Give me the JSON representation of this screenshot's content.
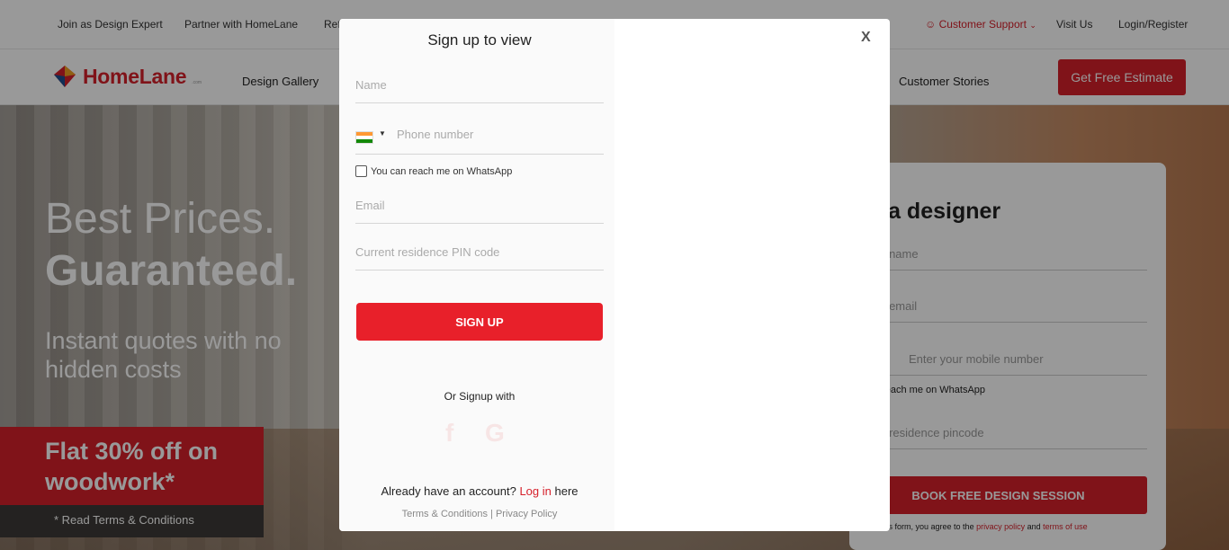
{
  "topbar": {
    "links": [
      "Join as Design Expert",
      "Partner with HomeLane",
      "Ref"
    ],
    "support": "Customer Support",
    "visit": "Visit Us",
    "login": "Login/Register"
  },
  "nav": {
    "brand": "HomeLane",
    "brand_tm": ".com",
    "links": [
      "Design Gallery",
      "Customer Stories"
    ],
    "cta": "Get Free Estimate"
  },
  "hero": {
    "line1": "Best Prices.",
    "line2": "Guaranteed.",
    "subtitle": "Instant quotes with no hidden costs",
    "offer": "Flat 30% off on woodwork*",
    "terms": "* Read Terms & Conditions"
  },
  "designer_card": {
    "title": "eet a designer",
    "name_ph": "er your name",
    "email_ph": "er your email",
    "mobile_ph": "Enter your mobile number",
    "whatsapp": "ou can reach me on WhatsApp",
    "pincode_ph": "er your residence pincode",
    "button": "BOOK FREE DESIGN SESSION",
    "note_prefix": "omitting this form, you agree to the ",
    "privacy": "privacy policy",
    "and": " and ",
    "terms": "terms of use"
  },
  "modal": {
    "title": "Sign up to view",
    "close": "X",
    "name_ph": "Name",
    "phone_ph": "Phone number",
    "whatsapp": "You can reach me on WhatsApp",
    "email_ph": "Email",
    "pin_ph": "Current residence PIN code",
    "signup": "SIGN UP",
    "or": "Or Signup with",
    "social": {
      "facebook": "f",
      "google": "G"
    },
    "already_prefix": "Already have an account?",
    "login": "Log in",
    "already_suffix": "here",
    "terms": "Terms & Conditions",
    "sep": "|",
    "privacy": "Privacy Policy"
  },
  "colors": {
    "brand_red": "#d6202b",
    "signup_red": "#e8202a"
  }
}
